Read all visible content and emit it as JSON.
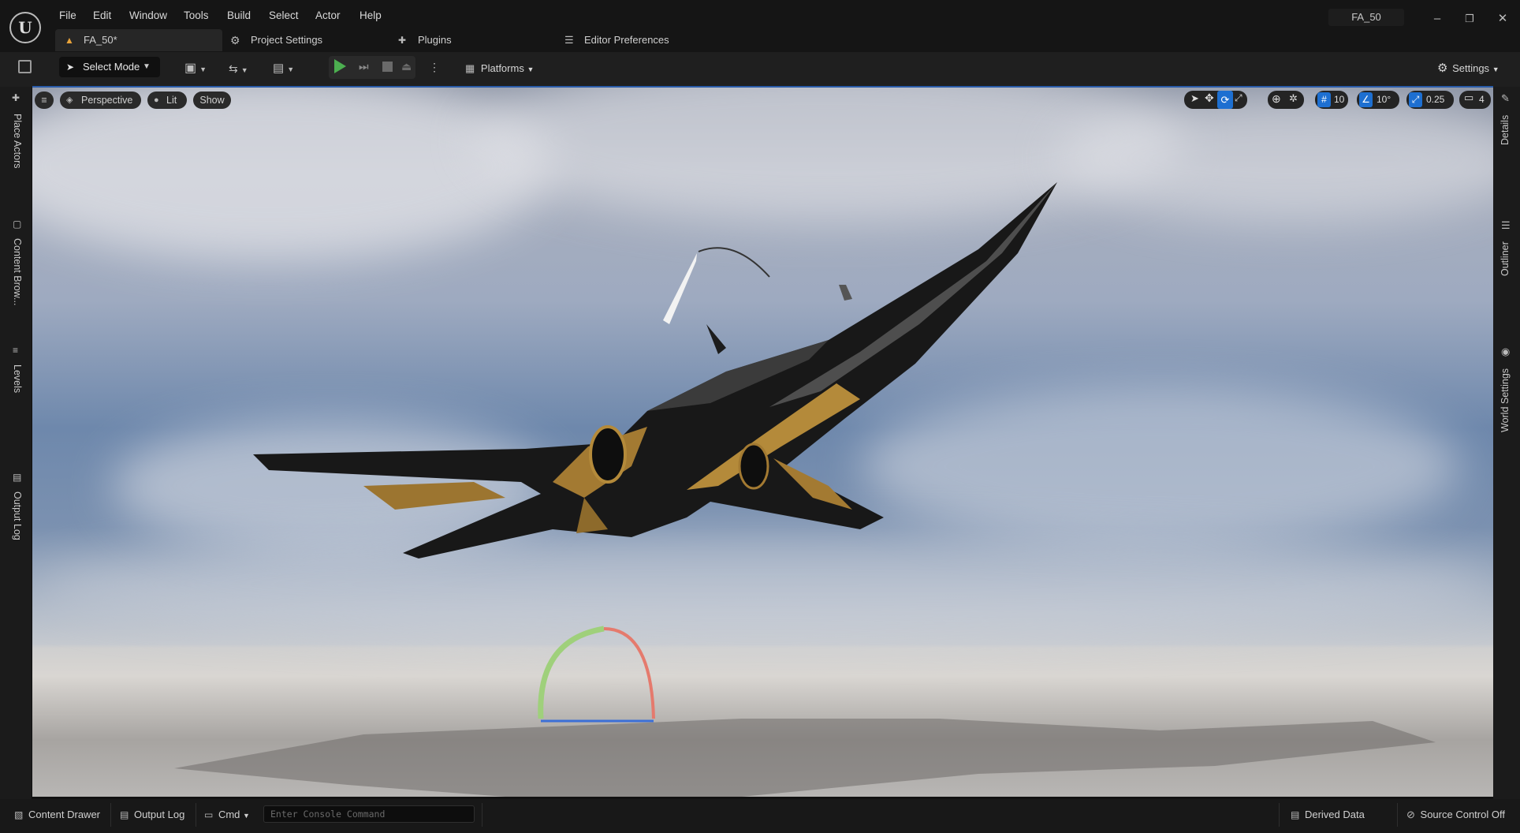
{
  "app": {
    "logo_text": "U"
  },
  "menubar": {
    "items": [
      "File",
      "Edit",
      "Window",
      "Tools",
      "Build",
      "Select",
      "Actor",
      "Help"
    ]
  },
  "title": {
    "project": "FA_50"
  },
  "tabs": {
    "level": "FA_50*",
    "project_settings": "Project Settings",
    "plugins": "Plugins",
    "editor_preferences": "Editor Preferences"
  },
  "toolbar": {
    "select_mode": "Select Mode",
    "platforms": "Platforms",
    "settings": "Settings"
  },
  "viewport": {
    "perspective": "Perspective",
    "lit": "Lit",
    "show": "Show",
    "grid_snap": "10",
    "rotation_snap": "10°",
    "scale_snap": "0.25",
    "camera_speed": "4"
  },
  "left_panels": [
    "Place Actors",
    "Content Brow...",
    "Levels",
    "Output Log"
  ],
  "right_panels": [
    "Details",
    "Outliner",
    "World Settings"
  ],
  "statusbar": {
    "content_drawer": "Content Drawer",
    "output_log": "Output Log",
    "cmd": "Cmd",
    "console_placeholder": "Enter Console Command",
    "derived_data": "Derived Data",
    "source_control": "Source Control Off"
  },
  "colors": {
    "accent_blue": "#1d6fd1",
    "play_green": "#4caf50",
    "tab_warning": "#e8a33a"
  }
}
